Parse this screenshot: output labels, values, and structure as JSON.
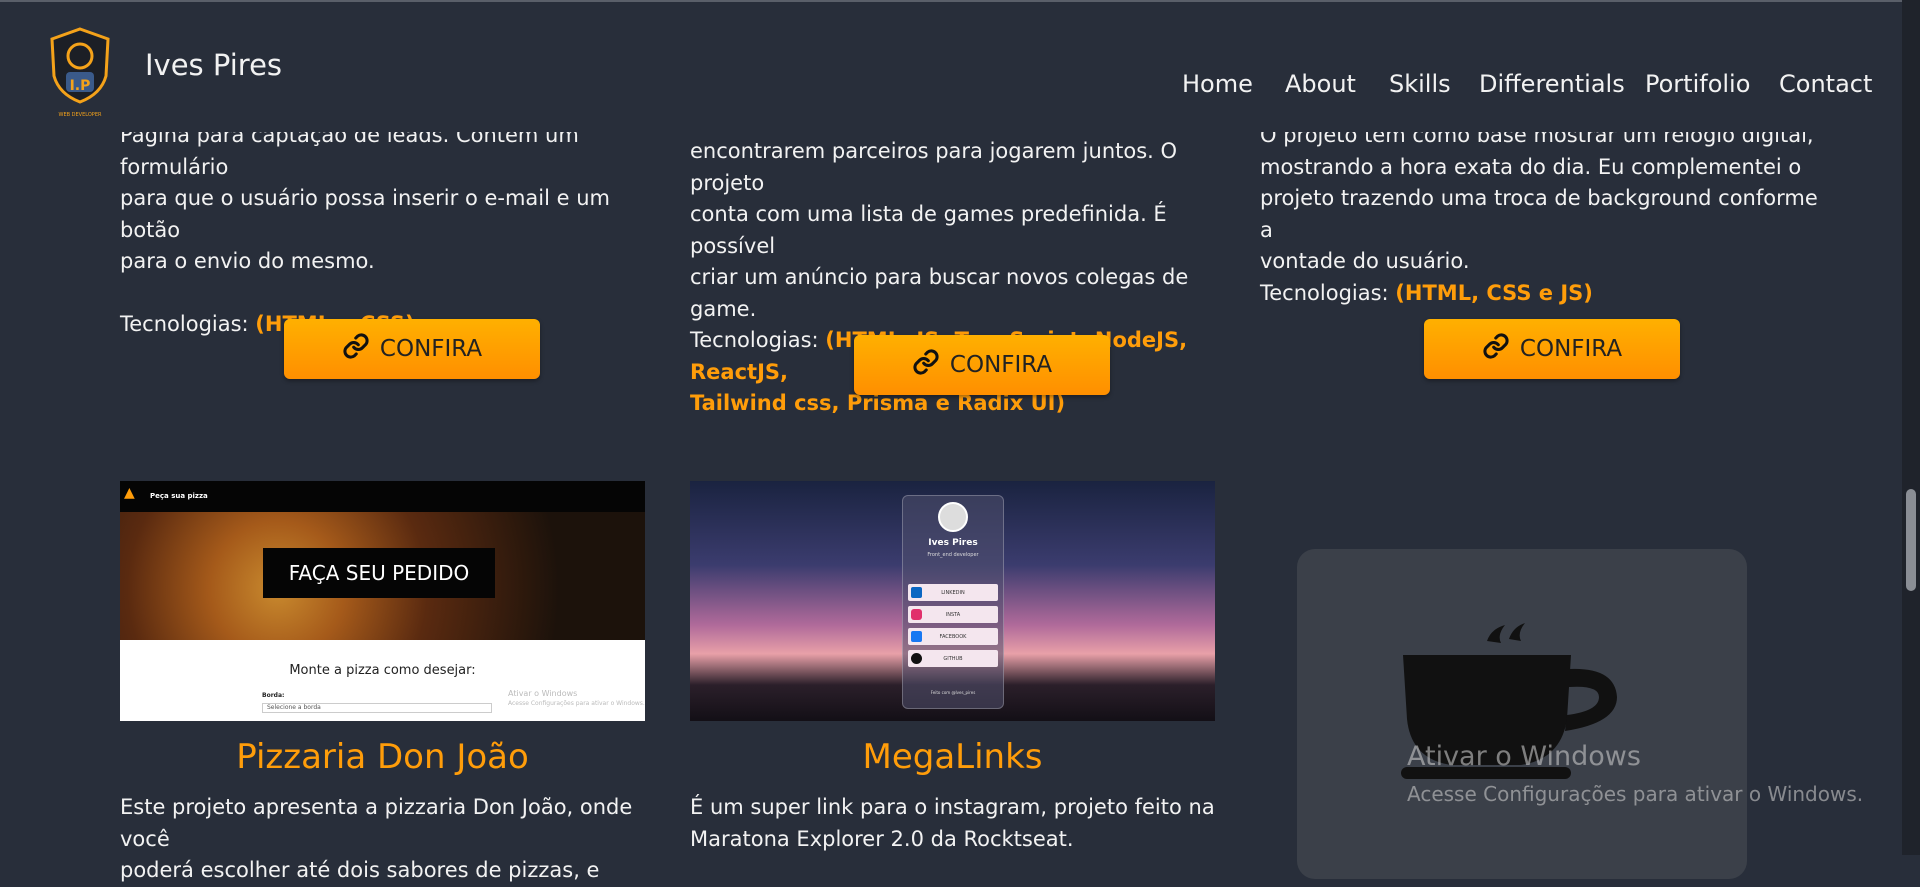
{
  "header": {
    "brand": "Ives Pires",
    "logo_initials": "I.P",
    "logo_caption": "WEB DEVELOPER",
    "nav": [
      "Home",
      "About",
      "Skills",
      "Differentials",
      "Portifolio",
      "Contact"
    ]
  },
  "cards_top": [
    {
      "desc_lines": [
        "Página para captação de leads. Contém um formulário",
        "para que o usuário possa inserir o e-mail e um botão",
        "para o envio do mesmo."
      ],
      "tech_label": "Tecnologias: ",
      "tech_values": [
        "(HTML e CSS)"
      ],
      "button": "CONFIRA"
    },
    {
      "desc_lines": [
        "encontrarem parceiros para jogarem juntos. O projeto",
        "conta com uma lista de games predefinida. É possível",
        "criar um anúncio para buscar novos colegas de game."
      ],
      "tech_label": "Tecnologias: ",
      "tech_values": [
        "(HTML, JS, TypeScript, NodeJS, ReactJS,",
        "Tailwind css, Prisma e Radix UI)"
      ],
      "button": "CONFIRA"
    },
    {
      "desc_lines": [
        "O projeto tem como base mostrar um relógio digital,",
        "mostrando a hora exata do dia. Eu complementei o",
        "projeto trazendo uma troca de background conforme a",
        "vontade do usuário."
      ],
      "tech_label": "Tecnologias: ",
      "tech_values": [
        "(HTML, CSS e JS)"
      ],
      "button": "CONFIRA"
    }
  ],
  "cards_bottom": [
    {
      "title": "Pizzaria Don João",
      "thumb": {
        "nav": "Peça sua pizza",
        "hero": "FAÇA SEU PEDIDO",
        "heading": "Monte a pizza como desejar:",
        "field": "Borda:",
        "select": "Selecione a borda",
        "wm1": "Ativar o Windows",
        "wm2": "Acesse Configurações para ativar o Windows."
      },
      "desc_lines": [
        "Este projeto apresenta a pizzaria Don João, onde você",
        "poderá escolher até dois sabores de pizzas, e"
      ]
    },
    {
      "title": "MegaLinks",
      "thumb": {
        "name": "Ives Pires",
        "role": "Front_end developer",
        "links": [
          "LINKEDIN",
          "INSTA",
          "FACEBOOK",
          "GITHUB"
        ],
        "footer": "Feito com @Ives_pires"
      },
      "desc_lines": [
        "É um super link para o instagram, projeto feito na",
        "Maratona Explorer 2.0 da Rocktseat."
      ]
    }
  ],
  "placeholder_icon": "coffee-cup-icon",
  "watermark": {
    "line1": "Ativar o Windows",
    "line2": "Acesse Configurações para ativar o Windows."
  },
  "colors": {
    "background": "#282e3a",
    "accent": "#ff9d0a",
    "button": "#ffa600"
  }
}
